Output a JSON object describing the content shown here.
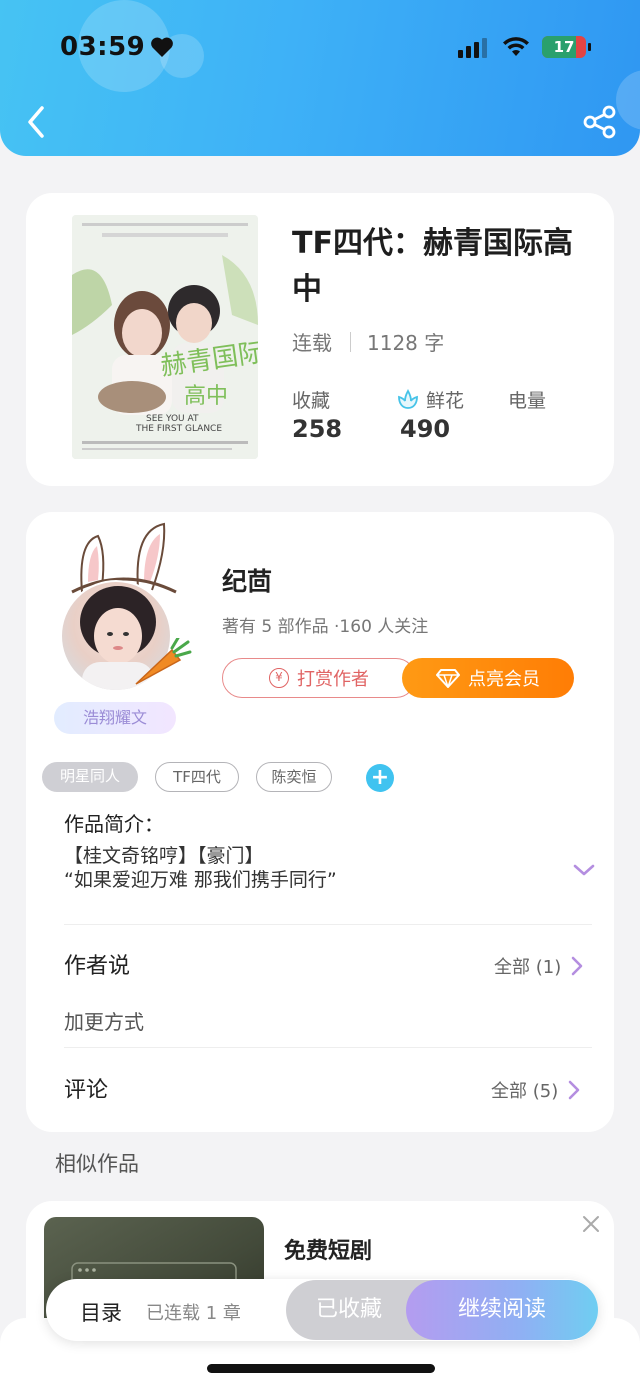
{
  "status_bar": {
    "time": "03:59",
    "battery": "17"
  },
  "book": {
    "title": "TF四代：赫青国际高中",
    "status": "连载",
    "word_count": "1128 字",
    "stats": [
      {
        "label": "收藏",
        "value": "258",
        "icon": ""
      },
      {
        "label": "鲜花",
        "value": "490",
        "icon": "flower-icon"
      },
      {
        "label": "电量",
        "value": "",
        "icon": ""
      }
    ]
  },
  "author": {
    "name": "纪茴",
    "info": "著有 5 部作品 ·160 人关注",
    "badge": "浩翔耀文",
    "tip_button": "打赏作者",
    "vip_button": "点亮会员",
    "tags": [
      "明星同人",
      "TF四代",
      "陈奕恒"
    ]
  },
  "intro": {
    "label": "作品简介：",
    "line1": "【桂文奇铭哼】【豪门】",
    "line2": "“如果爱迎万难 那我们携手同行”"
  },
  "author_says": {
    "title": "作者说",
    "link": "全部 (1)",
    "content": "加更方式"
  },
  "comments": {
    "title": "评论",
    "link": "全部 (5)"
  },
  "similar": {
    "section_title": "相似作品",
    "item_title": "免费短剧"
  },
  "bottom_bar": {
    "toc": "目录",
    "chapter_count": "已连载 1 章",
    "collected": "已收藏",
    "continue": "继续阅读"
  },
  "colors": {
    "header": "#3eb1f7",
    "accent_orange": "#ff8a0c",
    "tip_red": "#e06363",
    "add_blue": "#40c3f0",
    "chevron_purple": "#b48ee0"
  }
}
